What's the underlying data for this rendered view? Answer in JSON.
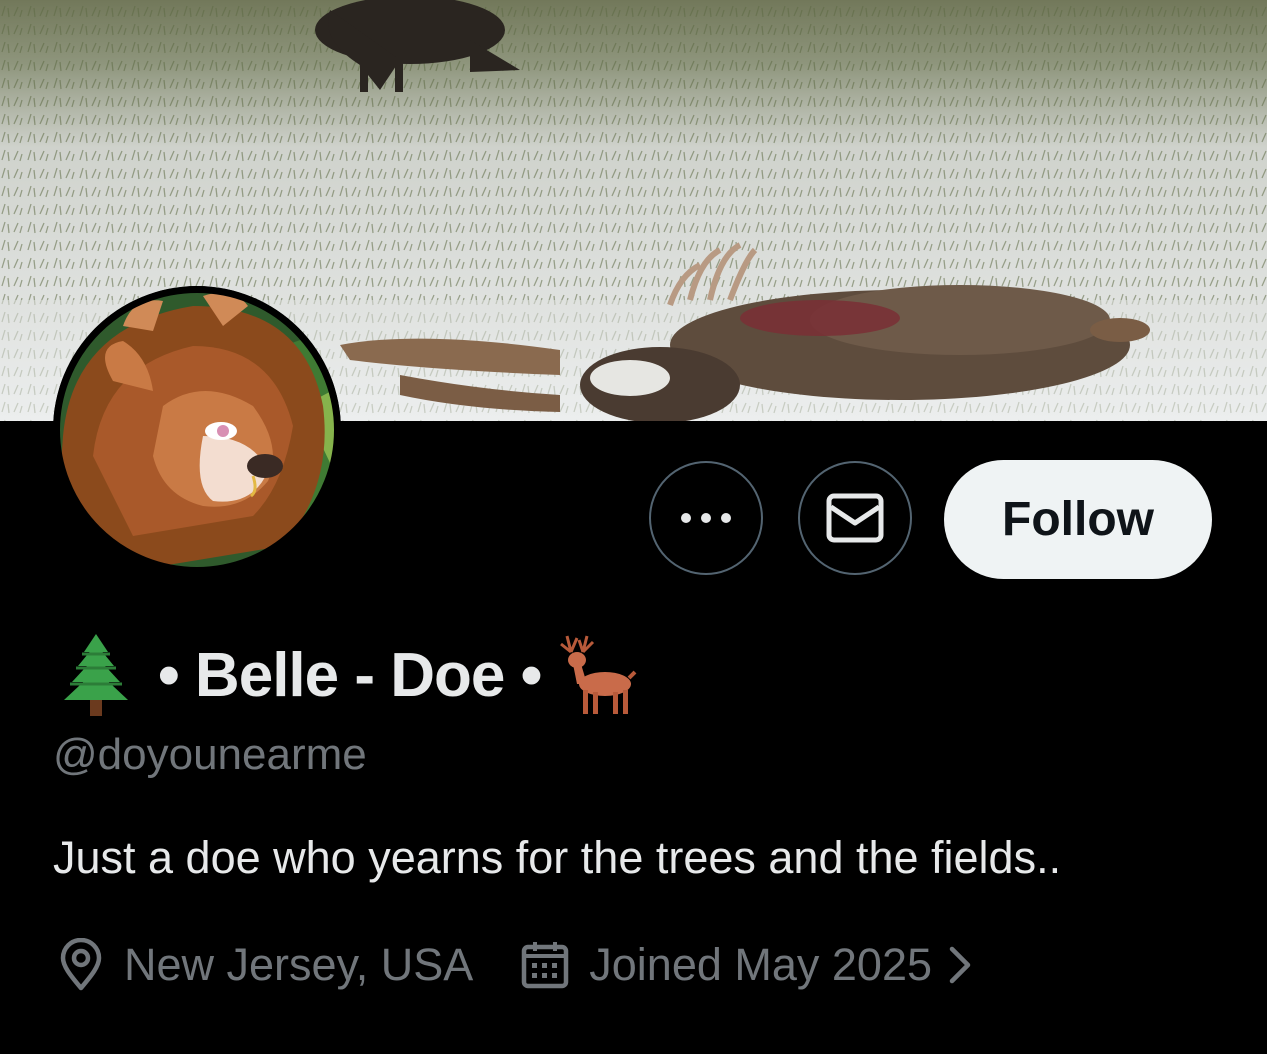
{
  "profile": {
    "display_name": "• Belle - Doe •",
    "handle": "@doyounearme",
    "bio": "Just a doe who yearns for the trees and the fields..",
    "location": "New Jersey, USA",
    "joined": "Joined May 2025"
  },
  "actions": {
    "follow_label": "Follow",
    "more_icon": "more-horizontal-icon",
    "message_icon": "envelope-icon"
  },
  "emojis": {
    "leading": "evergreen-tree",
    "trailing": "deer"
  },
  "icons": {
    "location": "map-pin-icon",
    "calendar": "calendar-icon",
    "chevron": "chevron-right-icon"
  },
  "colors": {
    "background": "#000000",
    "primary_text": "#e7e9ea",
    "secondary_text": "#71767b",
    "button_border": "#536471",
    "follow_bg": "#eff3f4"
  }
}
